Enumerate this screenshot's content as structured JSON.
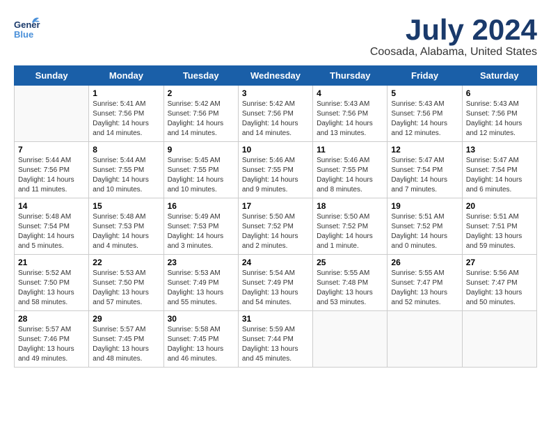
{
  "header": {
    "logo_general": "General",
    "logo_blue": "Blue",
    "month_title": "July 2024",
    "location": "Coosada, Alabama, United States"
  },
  "days_of_week": [
    "Sunday",
    "Monday",
    "Tuesday",
    "Wednesday",
    "Thursday",
    "Friday",
    "Saturday"
  ],
  "weeks": [
    [
      {
        "day": "",
        "info": ""
      },
      {
        "day": "1",
        "info": "Sunrise: 5:41 AM\nSunset: 7:56 PM\nDaylight: 14 hours\nand 14 minutes."
      },
      {
        "day": "2",
        "info": "Sunrise: 5:42 AM\nSunset: 7:56 PM\nDaylight: 14 hours\nand 14 minutes."
      },
      {
        "day": "3",
        "info": "Sunrise: 5:42 AM\nSunset: 7:56 PM\nDaylight: 14 hours\nand 14 minutes."
      },
      {
        "day": "4",
        "info": "Sunrise: 5:43 AM\nSunset: 7:56 PM\nDaylight: 14 hours\nand 13 minutes."
      },
      {
        "day": "5",
        "info": "Sunrise: 5:43 AM\nSunset: 7:56 PM\nDaylight: 14 hours\nand 12 minutes."
      },
      {
        "day": "6",
        "info": "Sunrise: 5:43 AM\nSunset: 7:56 PM\nDaylight: 14 hours\nand 12 minutes."
      }
    ],
    [
      {
        "day": "7",
        "info": "Sunrise: 5:44 AM\nSunset: 7:56 PM\nDaylight: 14 hours\nand 11 minutes."
      },
      {
        "day": "8",
        "info": "Sunrise: 5:44 AM\nSunset: 7:55 PM\nDaylight: 14 hours\nand 10 minutes."
      },
      {
        "day": "9",
        "info": "Sunrise: 5:45 AM\nSunset: 7:55 PM\nDaylight: 14 hours\nand 10 minutes."
      },
      {
        "day": "10",
        "info": "Sunrise: 5:46 AM\nSunset: 7:55 PM\nDaylight: 14 hours\nand 9 minutes."
      },
      {
        "day": "11",
        "info": "Sunrise: 5:46 AM\nSunset: 7:55 PM\nDaylight: 14 hours\nand 8 minutes."
      },
      {
        "day": "12",
        "info": "Sunrise: 5:47 AM\nSunset: 7:54 PM\nDaylight: 14 hours\nand 7 minutes."
      },
      {
        "day": "13",
        "info": "Sunrise: 5:47 AM\nSunset: 7:54 PM\nDaylight: 14 hours\nand 6 minutes."
      }
    ],
    [
      {
        "day": "14",
        "info": "Sunrise: 5:48 AM\nSunset: 7:54 PM\nDaylight: 14 hours\nand 5 minutes."
      },
      {
        "day": "15",
        "info": "Sunrise: 5:48 AM\nSunset: 7:53 PM\nDaylight: 14 hours\nand 4 minutes."
      },
      {
        "day": "16",
        "info": "Sunrise: 5:49 AM\nSunset: 7:53 PM\nDaylight: 14 hours\nand 3 minutes."
      },
      {
        "day": "17",
        "info": "Sunrise: 5:50 AM\nSunset: 7:52 PM\nDaylight: 14 hours\nand 2 minutes."
      },
      {
        "day": "18",
        "info": "Sunrise: 5:50 AM\nSunset: 7:52 PM\nDaylight: 14 hours\nand 1 minute."
      },
      {
        "day": "19",
        "info": "Sunrise: 5:51 AM\nSunset: 7:52 PM\nDaylight: 14 hours\nand 0 minutes."
      },
      {
        "day": "20",
        "info": "Sunrise: 5:51 AM\nSunset: 7:51 PM\nDaylight: 13 hours\nand 59 minutes."
      }
    ],
    [
      {
        "day": "21",
        "info": "Sunrise: 5:52 AM\nSunset: 7:50 PM\nDaylight: 13 hours\nand 58 minutes."
      },
      {
        "day": "22",
        "info": "Sunrise: 5:53 AM\nSunset: 7:50 PM\nDaylight: 13 hours\nand 57 minutes."
      },
      {
        "day": "23",
        "info": "Sunrise: 5:53 AM\nSunset: 7:49 PM\nDaylight: 13 hours\nand 55 minutes."
      },
      {
        "day": "24",
        "info": "Sunrise: 5:54 AM\nSunset: 7:49 PM\nDaylight: 13 hours\nand 54 minutes."
      },
      {
        "day": "25",
        "info": "Sunrise: 5:55 AM\nSunset: 7:48 PM\nDaylight: 13 hours\nand 53 minutes."
      },
      {
        "day": "26",
        "info": "Sunrise: 5:55 AM\nSunset: 7:47 PM\nDaylight: 13 hours\nand 52 minutes."
      },
      {
        "day": "27",
        "info": "Sunrise: 5:56 AM\nSunset: 7:47 PM\nDaylight: 13 hours\nand 50 minutes."
      }
    ],
    [
      {
        "day": "28",
        "info": "Sunrise: 5:57 AM\nSunset: 7:46 PM\nDaylight: 13 hours\nand 49 minutes."
      },
      {
        "day": "29",
        "info": "Sunrise: 5:57 AM\nSunset: 7:45 PM\nDaylight: 13 hours\nand 48 minutes."
      },
      {
        "day": "30",
        "info": "Sunrise: 5:58 AM\nSunset: 7:45 PM\nDaylight: 13 hours\nand 46 minutes."
      },
      {
        "day": "31",
        "info": "Sunrise: 5:59 AM\nSunset: 7:44 PM\nDaylight: 13 hours\nand 45 minutes."
      },
      {
        "day": "",
        "info": ""
      },
      {
        "day": "",
        "info": ""
      },
      {
        "day": "",
        "info": ""
      }
    ]
  ]
}
